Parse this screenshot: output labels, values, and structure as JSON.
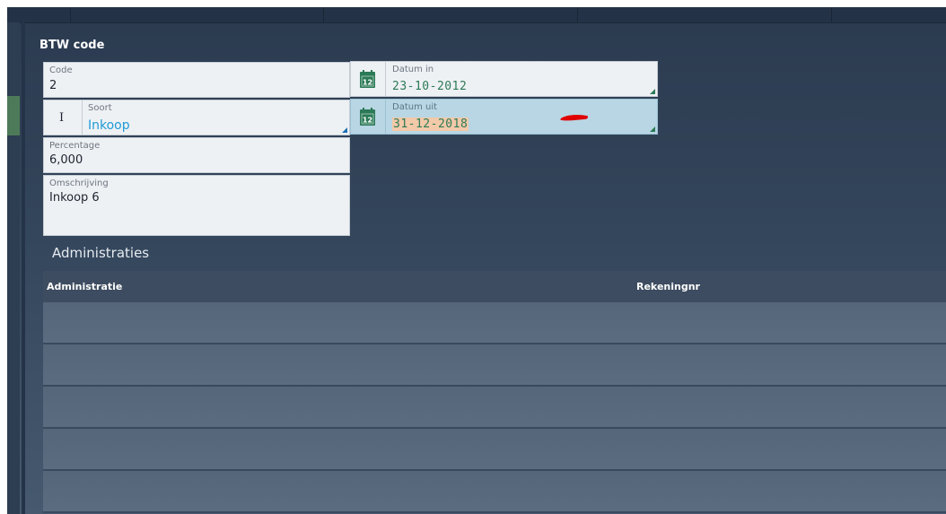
{
  "form": {
    "title": "BTW code",
    "code": {
      "label": "Code",
      "value": "2"
    },
    "soort": {
      "prefix": "I",
      "label": "Soort",
      "value": "Inkoop"
    },
    "percentage": {
      "label": "Percentage",
      "value": "6,000"
    },
    "omschrijving": {
      "label": "Omschrijving",
      "value": "Inkoop 6"
    },
    "datum_in": {
      "label": "Datum in",
      "value": "23-10-2012",
      "icon": "calendar-icon"
    },
    "datum_uit": {
      "label": "Datum uit",
      "value": "31-12-2018",
      "icon": "calendar-icon"
    }
  },
  "administraties": {
    "title": "Administraties",
    "columns": [
      "Administratie",
      "Rekeningnr"
    ],
    "rows": []
  },
  "colors": {
    "accent_green": "#2c7a57",
    "accent_blue": "#1f9ad6",
    "annotation_red": "#e00000"
  }
}
